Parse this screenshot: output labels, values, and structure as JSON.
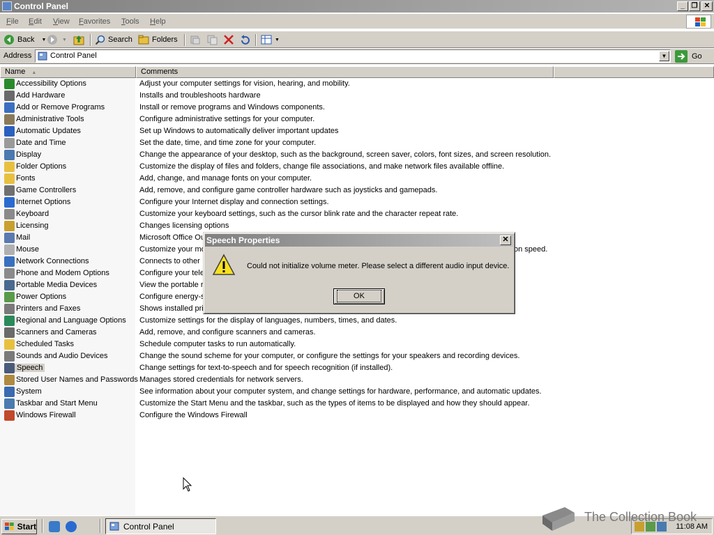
{
  "window": {
    "title": "Control Panel",
    "buttons": [
      "_",
      "❐",
      "✕"
    ]
  },
  "menu": [
    "File",
    "Edit",
    "View",
    "Favorites",
    "Tools",
    "Help"
  ],
  "toolbar": {
    "back": "Back",
    "search": "Search",
    "folders": "Folders"
  },
  "address": {
    "label": "Address",
    "value": "Control Panel",
    "go": "Go"
  },
  "columns": {
    "name": "Name",
    "comments": "Comments"
  },
  "items": [
    {
      "name": "Accessibility Options",
      "comment": "Adjust your computer settings for vision, hearing, and mobility.",
      "color": "#2a8a2a"
    },
    {
      "name": "Add Hardware",
      "comment": "Installs and troubleshoots hardware",
      "color": "#6a6a6a"
    },
    {
      "name": "Add or Remove Programs",
      "comment": "Install or remove programs and Windows components.",
      "color": "#3a6fc0"
    },
    {
      "name": "Administrative Tools",
      "comment": "Configure administrative settings for your computer.",
      "color": "#8a7a5a"
    },
    {
      "name": "Automatic Updates",
      "comment": "Set up Windows to automatically deliver important updates",
      "color": "#2a60c0"
    },
    {
      "name": "Date and Time",
      "comment": "Set the date, time, and time zone for your computer.",
      "color": "#9a9a9a"
    },
    {
      "name": "Display",
      "comment": "Change the appearance of your desktop, such as the background, screen saver, colors, font sizes, and screen resolution.",
      "color": "#4a7ab0"
    },
    {
      "name": "Folder Options",
      "comment": "Customize the display of files and folders, change file associations, and make network files available offline.",
      "color": "#e8c040"
    },
    {
      "name": "Fonts",
      "comment": "Add, change, and manage fonts on your computer.",
      "color": "#e8c040"
    },
    {
      "name": "Game Controllers",
      "comment": "Add, remove, and configure game controller hardware such as joysticks and gamepads.",
      "color": "#707070"
    },
    {
      "name": "Internet Options",
      "comment": "Configure your Internet display and connection settings.",
      "color": "#2a6ad0"
    },
    {
      "name": "Keyboard",
      "comment": "Customize your keyboard settings, such as the cursor blink rate and the character repeat rate.",
      "color": "#8a8a8a"
    },
    {
      "name": "Licensing",
      "comment": "Changes licensing options",
      "color": "#c8a030"
    },
    {
      "name": "Mail",
      "comment": "Microsoft Office Ou",
      "color": "#5a7ab0"
    },
    {
      "name": "Mouse",
      "comment": "Customize your mou",
      "color": "#b0b0b0"
    },
    {
      "name": "Network Connections",
      "comment": "Connects to other",
      "color": "#3a70c0"
    },
    {
      "name": "Phone and Modem Options",
      "comment": "Configure your tele",
      "color": "#8a8a8a"
    },
    {
      "name": "Portable Media Devices",
      "comment": "View the portable r",
      "color": "#4a6a90"
    },
    {
      "name": "Power Options",
      "comment": "Configure energy-s",
      "color": "#5a9a4a"
    },
    {
      "name": "Printers and Faxes",
      "comment": "Shows installed pri",
      "color": "#7a7a7a"
    },
    {
      "name": "Regional and Language Options",
      "comment": "Customize settings for the display of languages, numbers, times, and dates.",
      "color": "#2a8a5a"
    },
    {
      "name": "Scanners and Cameras",
      "comment": "Add, remove, and configure scanners and cameras.",
      "color": "#6a6a6a"
    },
    {
      "name": "Scheduled Tasks",
      "comment": "Schedule computer tasks to run automatically.",
      "color": "#e8c040"
    },
    {
      "name": "Sounds and Audio Devices",
      "comment": "Change the sound scheme for your computer, or configure the settings for your speakers and recording devices.",
      "color": "#7a7a7a"
    },
    {
      "name": "Speech",
      "comment": "Change settings for text-to-speech and for speech recognition (if installed).",
      "color": "#4a5a7a",
      "selected": true
    },
    {
      "name": "Stored User Names and Passwords",
      "comment": "Manages stored credentials for network servers.",
      "color": "#b08a40"
    },
    {
      "name": "System",
      "comment": "See information about your computer system, and change settings for hardware, performance, and automatic updates.",
      "color": "#3a6ab0"
    },
    {
      "name": "Taskbar and Start Menu",
      "comment": "Customize the Start Menu and the taskbar, such as the types of items to be displayed and how they should appear.",
      "color": "#4a7ab0"
    },
    {
      "name": "Windows Firewall",
      "comment": "Configure the Windows Firewall",
      "color": "#c04a2a"
    }
  ],
  "mouse_suffix": "on speed.",
  "dialog": {
    "title": "Speech Properties",
    "message": "Could not initialize volume meter.  Please select a different audio input device.",
    "ok": "OK",
    "close": "✕"
  },
  "taskbar": {
    "start": "Start",
    "task": "Control Panel",
    "clock": "11:08 AM"
  },
  "watermark": "The Collection Book"
}
